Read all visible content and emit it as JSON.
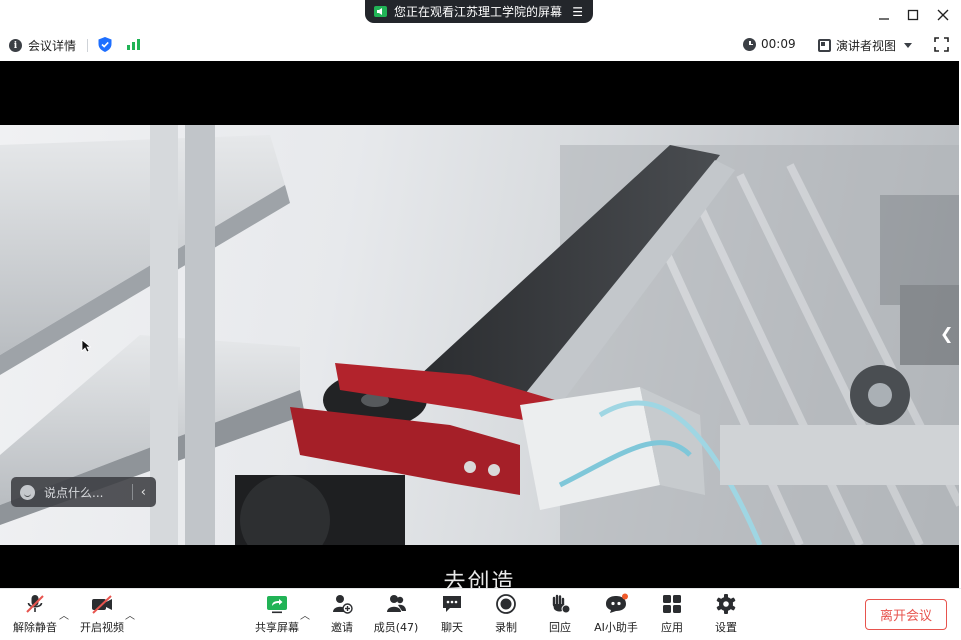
{
  "window": {
    "share_banner": "您正在观看江苏理工学院的屏幕",
    "share_menu_icon": "hamburger-icon"
  },
  "infobar": {
    "meeting_info_label": "会议详情",
    "timer": "00:09",
    "view_label": "演讲者视图"
  },
  "video": {
    "subtitle": "去创造"
  },
  "chat": {
    "placeholder": "说点什么..."
  },
  "toolbar": {
    "unmute": "解除静音",
    "start_video": "开启视频",
    "share_screen": "共享屏幕",
    "invite": "邀请",
    "members": "成员(47)",
    "chat": "聊天",
    "record": "录制",
    "react": "回应",
    "ai_assistant": "AI小助手",
    "apps": "应用",
    "settings": "设置",
    "leave": "离开会议"
  },
  "colors": {
    "accent_green": "#21b356",
    "shield_blue": "#1e6fff",
    "danger_red": "#e7544e",
    "share_pill": "#23262b"
  }
}
